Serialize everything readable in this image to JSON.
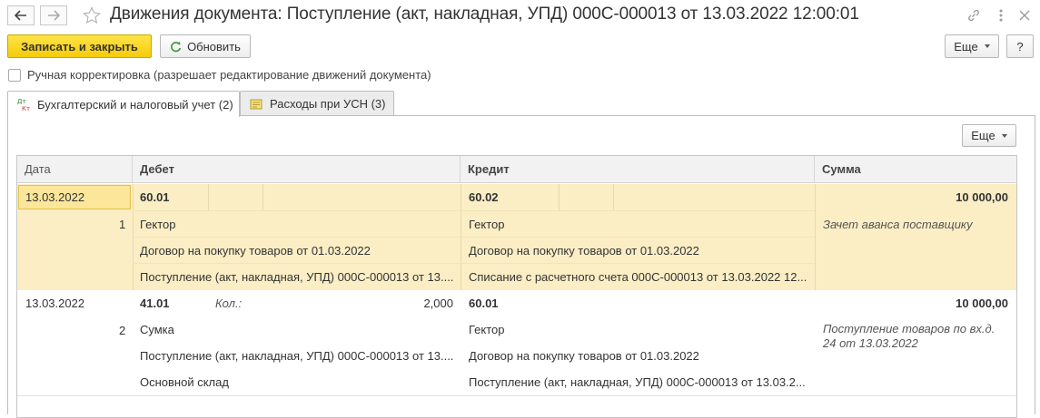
{
  "window": {
    "title": "Движения документа: Поступление (акт, накладная, УПД) 000С-000013 от 13.03.2022 12:00:01"
  },
  "toolbar": {
    "save_close": "Записать и закрыть",
    "refresh": "Обновить",
    "more": "Еще",
    "help": "?"
  },
  "manual_correction": {
    "label": "Ручная корректировка (разрешает редактирование движений документа)",
    "checked": false
  },
  "tabs": [
    {
      "label": "Бухгалтерский и налоговый учет (2)",
      "active": true
    },
    {
      "label": "Расходы при УСН (3)",
      "active": false
    }
  ],
  "grid": {
    "more": "Еще",
    "columns": [
      "Дата",
      "Дебет",
      "Кредит",
      "Сумма"
    ],
    "rows": [
      {
        "date": "13.03.2022",
        "num": "1",
        "debit_account": "60.01",
        "debit_qty_label": "",
        "debit_qty": "",
        "debit_sub": [
          "Гектор",
          "Договор на покупку товаров от 01.03.2022",
          "Поступление (акт, накладная, УПД) 000С-000013 от 13...."
        ],
        "credit_account": "60.02",
        "credit_sub": [
          "Гектор",
          "Договор на покупку товаров от 01.03.2022",
          "Списание с расчетного счета 000С-000013 от 13.03.2022 12..."
        ],
        "amount": "10 000,00",
        "comment": "Зачет аванса поставщику"
      },
      {
        "date": "13.03.2022",
        "num": "2",
        "debit_account": "41.01",
        "debit_qty_label": "Кол.:",
        "debit_qty": "2,000",
        "debit_sub": [
          "Сумка",
          "Поступление (акт, накладная, УПД) 000С-000013 от 13....",
          "Основной склад"
        ],
        "credit_account": "60.01",
        "credit_sub": [
          "Гектор",
          "Договор на покупку товаров от 01.03.2022",
          "Поступление (акт, накладная, УПД) 000С-000013 от 13.03.2..."
        ],
        "amount": "10 000,00",
        "comment": "Поступление товаров по вх.д. 24 от 13.03.2022"
      }
    ]
  },
  "colors": {
    "primary_button": "#f5cc0a",
    "selected_row": "#fbeec5",
    "selected_cell": "#fbe69a"
  }
}
